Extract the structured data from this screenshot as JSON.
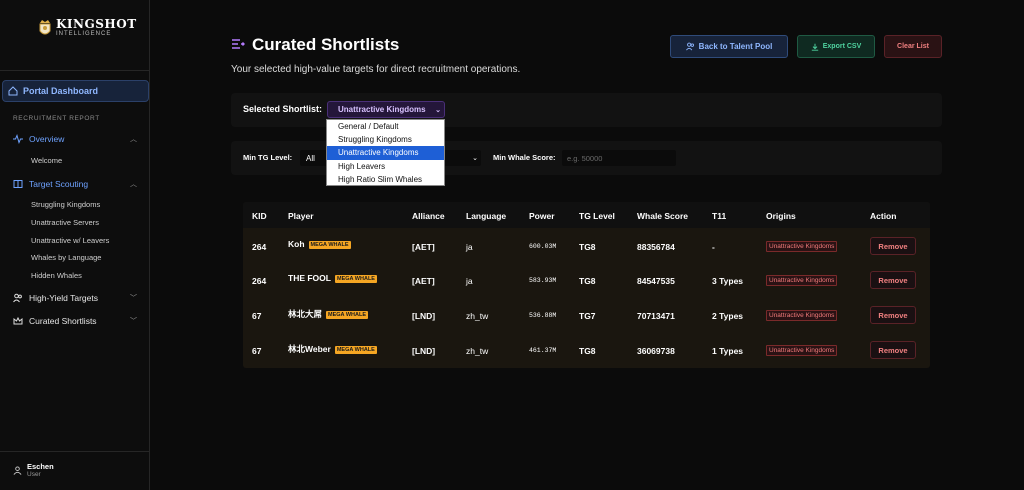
{
  "brand": {
    "name": "KINGSHOT",
    "tagline": "INTELLIGENCE"
  },
  "sidebar": {
    "dashboard": "Portal Dashboard",
    "section": "RECRUITMENT REPORT",
    "overview": {
      "label": "Overview",
      "items": [
        "Welcome"
      ]
    },
    "scouting": {
      "label": "Target Scouting",
      "items": [
        "Struggling Kingdoms",
        "Unattractive Servers",
        "Unattractive w/ Leavers",
        "Whales by Language",
        "Hidden Whales"
      ]
    },
    "high_yield": "High-Yield Targets",
    "shortlists": "Curated Shortlists",
    "user": {
      "name": "Eschen",
      "role": "User"
    }
  },
  "header": {
    "title": "Curated Shortlists",
    "subtitle": "Your selected high-value targets for direct recruitment operations.",
    "back_label": "Back to Talent Pool",
    "csv_label": "Export CSV",
    "clear_label": "Clear List"
  },
  "filters": {
    "shortlist_label": "Selected Shortlist:",
    "shortlist_value": "Unattractive Kingdoms",
    "shortlist_options": [
      "General / Default",
      "Struggling Kingdoms",
      "Unattractive Kingdoms",
      "High Leavers",
      "High Ratio Slim Whales"
    ],
    "min_tg_label": "Min TG Level:",
    "min_tg_value": "All",
    "min_whale_label": "Min Whale Score:",
    "min_whale_placeholder": "e.g. 50000"
  },
  "table": {
    "headers": [
      "KID",
      "Player",
      "Alliance",
      "Language",
      "Power",
      "TG Level",
      "Whale Score",
      "T11",
      "Origins",
      "Action"
    ],
    "badge": "MEGA WHALE",
    "remove_label": "Remove",
    "rows": [
      {
        "kid": "264",
        "player": "Koh",
        "alliance": "[AET]",
        "language": "ja",
        "power": "600.03M",
        "tg": "TG8",
        "whale": "88356784",
        "t11": "-",
        "origin": "Unattractive Kingdoms"
      },
      {
        "kid": "264",
        "player": "THE FOOL",
        "alliance": "[AET]",
        "language": "ja",
        "power": "583.93M",
        "tg": "TG8",
        "whale": "84547535",
        "t11": "3 Types",
        "origin": "Unattractive Kingdoms"
      },
      {
        "kid": "67",
        "player": "林北大屌",
        "alliance": "[LND]",
        "language": "zh_tw",
        "power": "536.88M",
        "tg": "TG7",
        "whale": "70713471",
        "t11": "2 Types",
        "origin": "Unattractive Kingdoms"
      },
      {
        "kid": "67",
        "player": "林北Weber",
        "alliance": "[LND]",
        "language": "zh_tw",
        "power": "461.37M",
        "tg": "TG8",
        "whale": "36069738",
        "t11": "1 Types",
        "origin": "Unattractive Kingdoms"
      }
    ]
  },
  "colors": {
    "accent": "#6ea2ff",
    "badge": "#f5a623",
    "danger": "#f08080",
    "success": "#4fd3a0"
  }
}
